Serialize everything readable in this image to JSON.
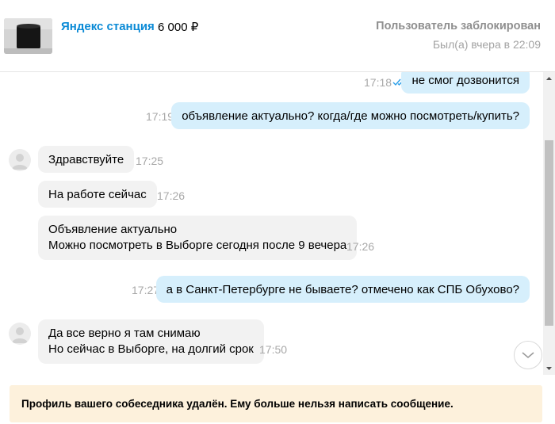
{
  "header": {
    "item_title": "Яндекс станция",
    "item_price": "6 000 ₽",
    "user_status": "Пользователь заблокирован",
    "last_seen": "Был(а) вчера в 22:09"
  },
  "messages": [
    {
      "direction": "out",
      "text": "не смог дозвонится",
      "time": "17:18",
      "read": true
    },
    {
      "direction": "out",
      "text": "объявление актуально? когда/где можно посмотреть/купить?",
      "time": "17:19",
      "read": true
    },
    {
      "direction": "in",
      "text": "Здравствуйте",
      "time": "17:25"
    },
    {
      "direction": "in",
      "text": "На работе сейчас",
      "time": "17:26"
    },
    {
      "direction": "in",
      "lines": [
        "Объявление актуально",
        "Можно посмотреть в Выборге сегодня после 9 вечера"
      ],
      "time": "17:26"
    },
    {
      "direction": "out",
      "text": "а в Санкт-Петербурге не бываете? отмечено как СПБ Обухово?",
      "time": "17:27",
      "read": true
    },
    {
      "direction": "in",
      "lines": [
        "Да все верно я там снимаю",
        "Но сейчас в Выборге, на долгий срок"
      ],
      "time": "17:50"
    }
  ],
  "notice": {
    "text": "Профиль вашего собеседника удалён. Ему больше нельзя написать сообщение."
  },
  "colors": {
    "link_blue": "#0a8ad6",
    "outgoing_bubble": "#d6effc",
    "incoming_bubble": "#f2f2f2",
    "notice_bg": "#fdf1dc",
    "read_ticks": "#2a9ee8"
  },
  "icons": {
    "read_status": "double-check-icon",
    "scroll_to_bottom": "chevron-down-icon",
    "avatar": "user-avatar-icon"
  }
}
